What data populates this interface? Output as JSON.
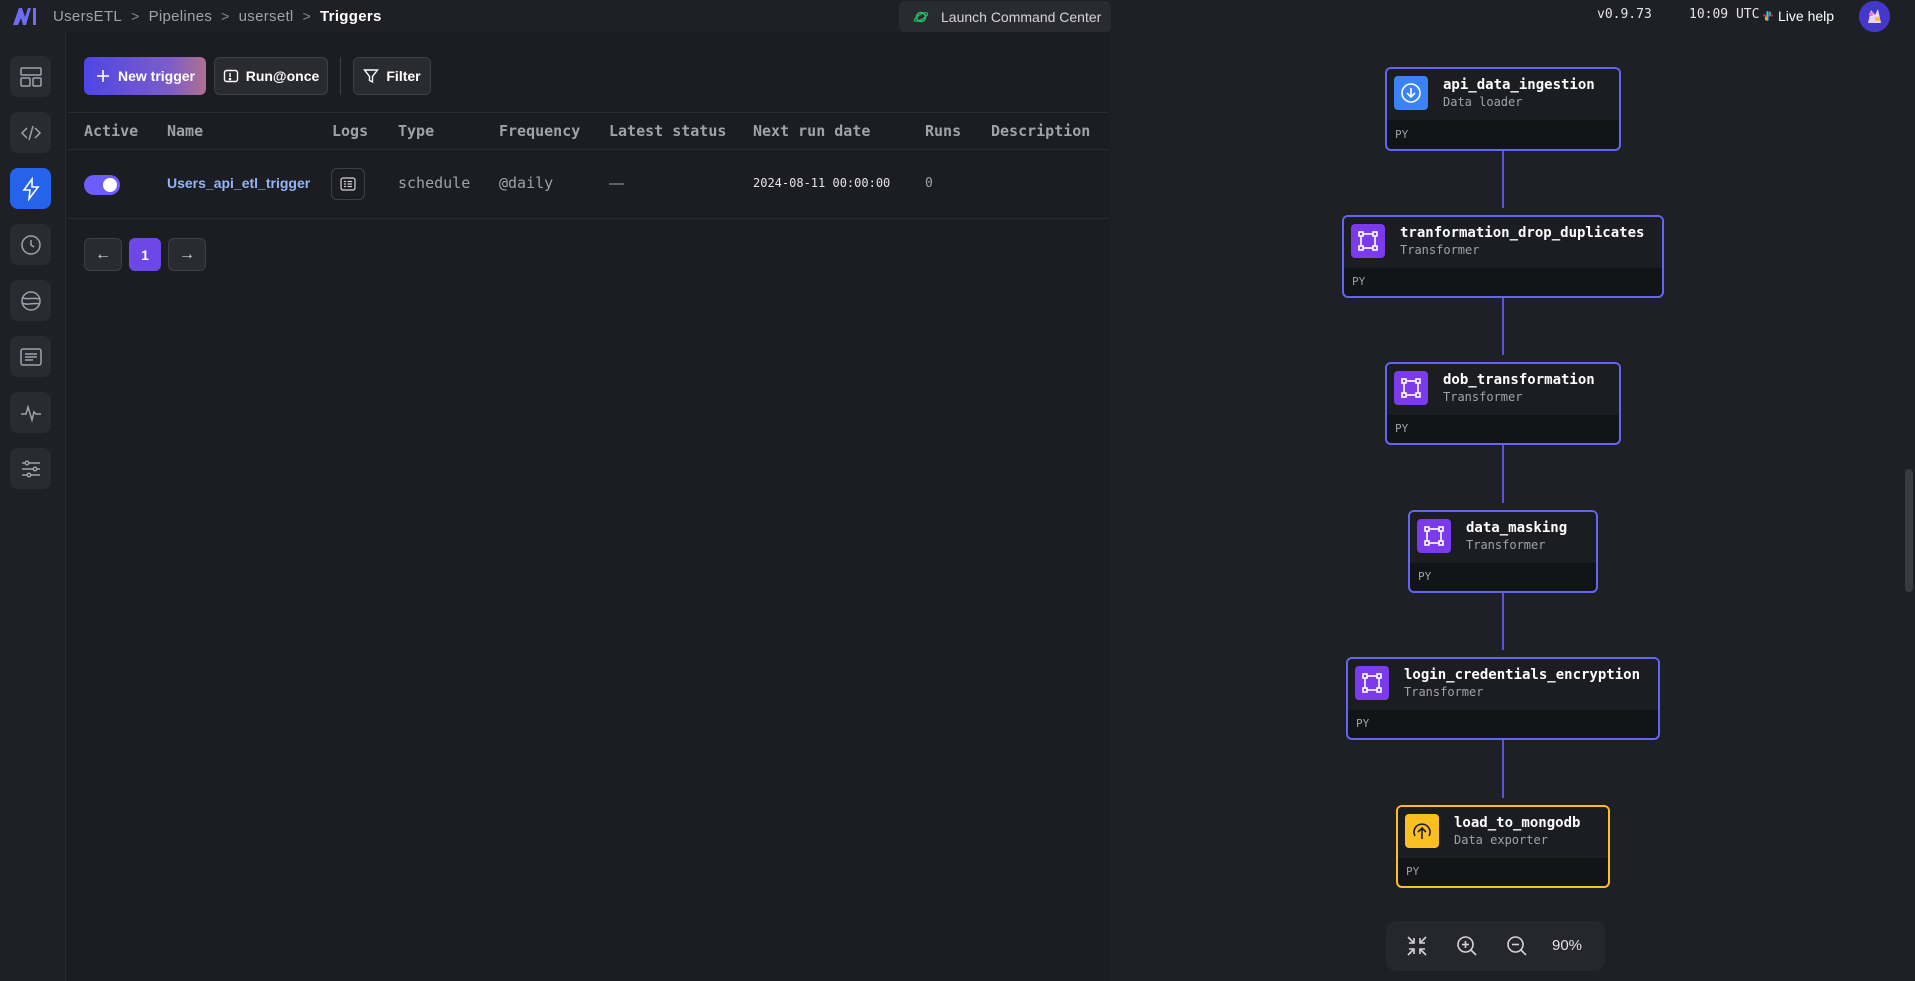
{
  "header": {
    "breadcrumb": [
      "UsersETL",
      "Pipelines",
      "usersetl",
      "Triggers"
    ],
    "separator": ">",
    "launch_label": "Launch Command Center",
    "version": "v0.9.73",
    "time": "10:09 UTC",
    "live_help": "Live help"
  },
  "sidebar": {
    "items": [
      {
        "name": "layout-icon",
        "active": false
      },
      {
        "name": "code-icon",
        "active": false
      },
      {
        "name": "lightning-icon",
        "active": true
      },
      {
        "name": "clock-icon",
        "active": false
      },
      {
        "name": "planet-icon",
        "active": false
      },
      {
        "name": "logs-icon",
        "active": false
      },
      {
        "name": "monitor-icon",
        "active": false
      },
      {
        "name": "sliders-icon",
        "active": false
      }
    ]
  },
  "toolbar": {
    "new_trigger": "New trigger",
    "run_once": "Run@once",
    "filter": "Filter"
  },
  "table": {
    "columns": [
      "Active",
      "Name",
      "Logs",
      "Type",
      "Frequency",
      "Latest status",
      "Next run date",
      "Runs",
      "Description"
    ],
    "rows": [
      {
        "active": true,
        "name": "Users_api_etl_trigger",
        "type": "schedule",
        "frequency": "@daily",
        "latest_status": "—",
        "next_run_date": "2024-08-11 00:00:00",
        "runs": "0",
        "description": ""
      }
    ]
  },
  "pagination": {
    "prev": "←",
    "current": "1",
    "next": "→"
  },
  "graph": {
    "nodes": [
      {
        "title": "api_data_ingestion",
        "subtitle": "Data loader",
        "lang": "PY",
        "kind": "loader"
      },
      {
        "title": "tranformation_drop_duplicates",
        "subtitle": "Transformer",
        "lang": "PY",
        "kind": "transformer"
      },
      {
        "title": "dob_transformation",
        "subtitle": "Transformer",
        "lang": "PY",
        "kind": "transformer"
      },
      {
        "title": "data_masking",
        "subtitle": "Transformer",
        "lang": "PY",
        "kind": "transformer"
      },
      {
        "title": "login_credentials_encryption",
        "subtitle": "Transformer",
        "lang": "PY",
        "kind": "transformer"
      },
      {
        "title": "load_to_mongodb",
        "subtitle": "Data exporter",
        "lang": "PY",
        "kind": "exporter"
      }
    ],
    "zoom": "90%",
    "colors": {
      "loader": "#3b82f6",
      "transformer": "#7c3aed",
      "exporter": "#fbbf24",
      "edge": "#5b52d6"
    }
  }
}
